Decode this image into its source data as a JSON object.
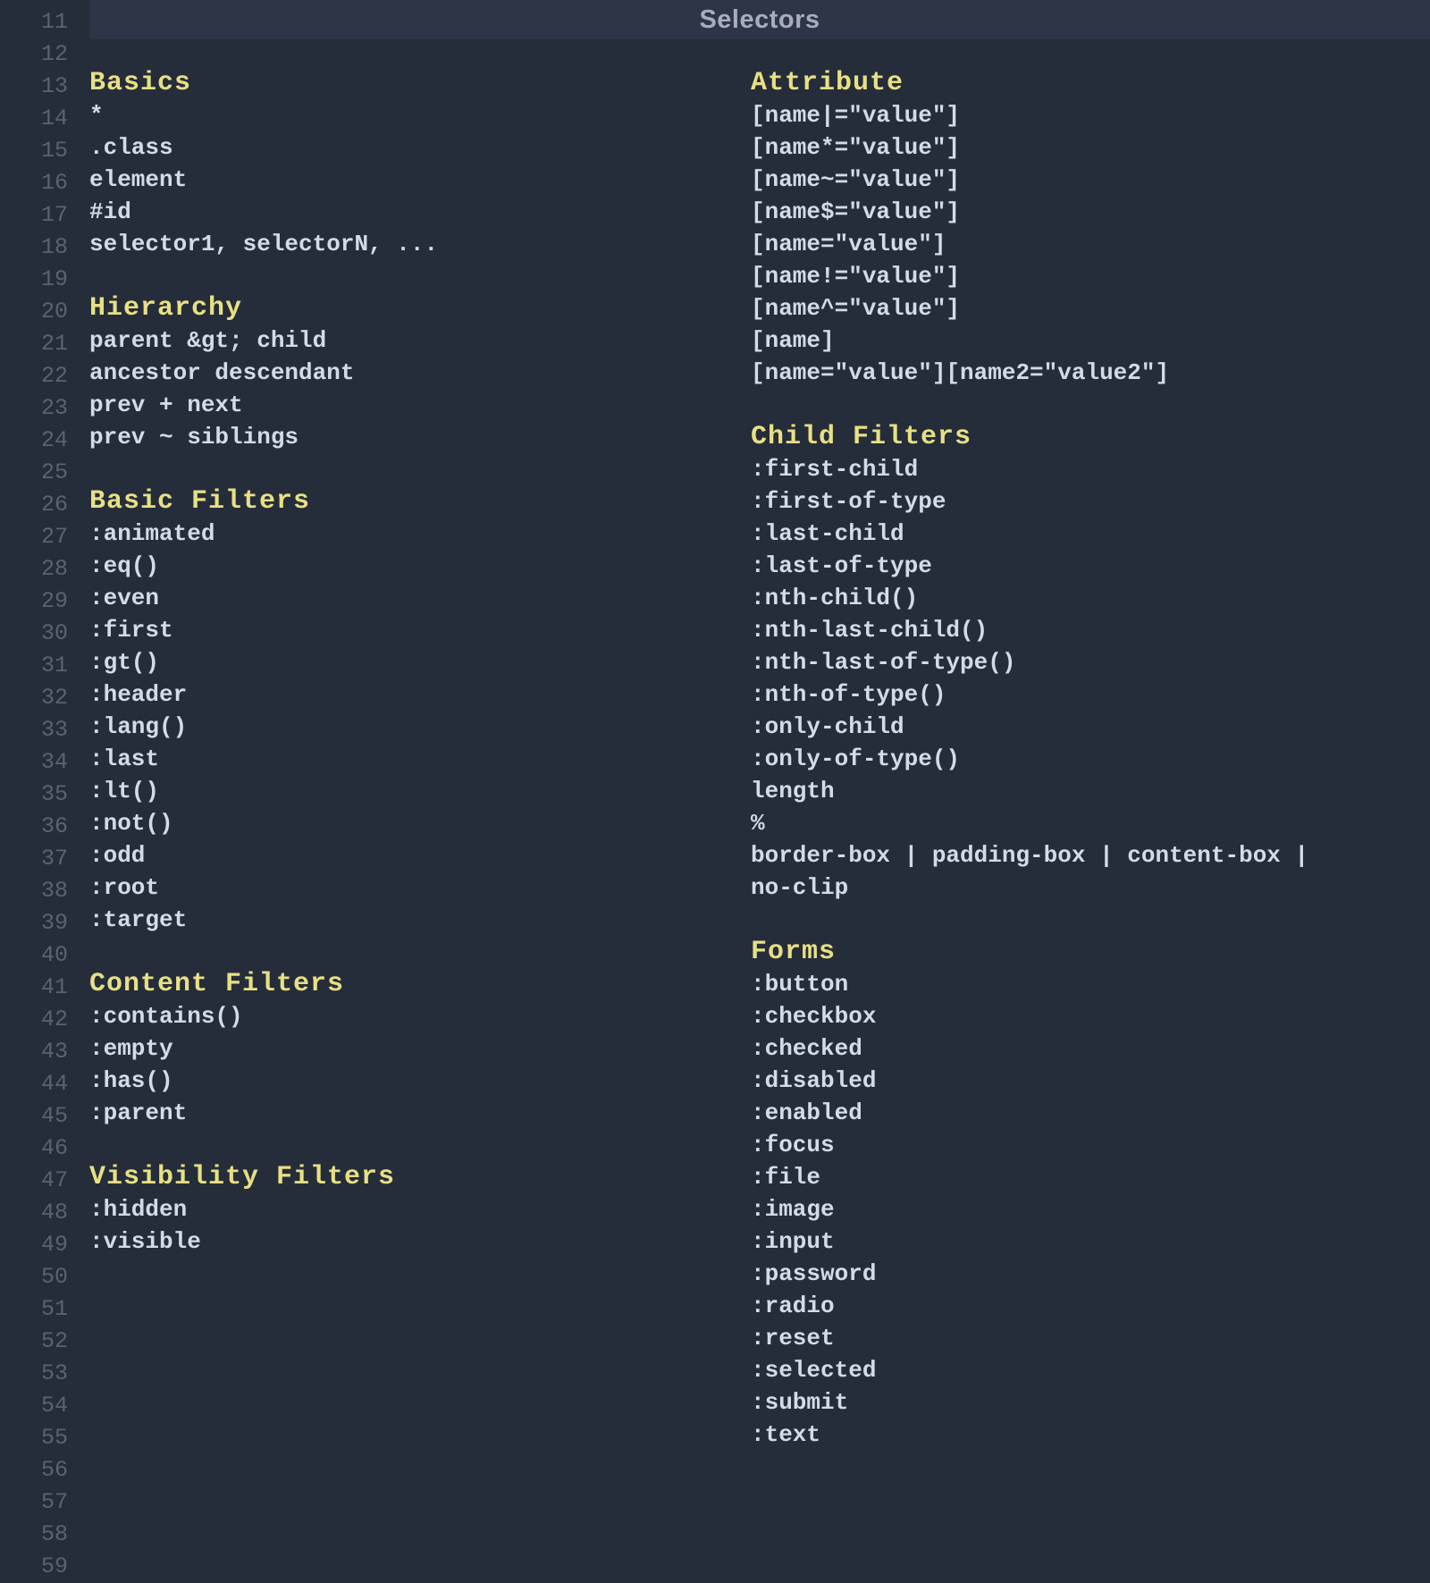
{
  "title": "Selectors",
  "line_start": 11,
  "line_end": 59,
  "columns": [
    {
      "sections": [
        {
          "heading": "Basics",
          "items": [
            "*",
            ".class",
            "element",
            "#id",
            "selector1, selectorN, ..."
          ]
        },
        {
          "heading": "Hierarchy",
          "items": [
            "parent &gt; child",
            "ancestor descendant",
            "prev + next",
            "prev ~ siblings"
          ]
        },
        {
          "heading": "Basic Filters",
          "items": [
            ":animated",
            ":eq()",
            ":even",
            ":first",
            ":gt()",
            ":header",
            ":lang()",
            ":last",
            ":lt()",
            ":not()",
            ":odd",
            ":root",
            ":target"
          ]
        },
        {
          "heading": "Content Filters",
          "items": [
            ":contains()",
            ":empty",
            ":has()",
            ":parent"
          ]
        },
        {
          "heading": "Visibility Filters",
          "items": [
            ":hidden",
            ":visible"
          ]
        }
      ]
    },
    {
      "sections": [
        {
          "heading": "Attribute",
          "items": [
            "[name|=\"value\"]",
            "[name*=\"value\"]",
            "[name~=\"value\"]",
            "[name$=\"value\"]",
            "[name=\"value\"]",
            "[name!=\"value\"]",
            "[name^=\"value\"]",
            "[name]",
            "[name=\"value\"][name2=\"value2\"]"
          ]
        },
        {
          "heading": "Child Filters",
          "items": [
            ":first-child",
            ":first-of-type",
            ":last-child",
            ":last-of-type",
            ":nth-child()",
            ":nth-last-child()",
            ":nth-last-of-type()",
            ":nth-of-type()",
            ":only-child",
            ":only-of-type()",
            "length",
            "%",
            "border-box | padding-box | content-box |",
            "no-clip"
          ]
        },
        {
          "heading": "Forms",
          "items": [
            ":button",
            ":checkbox",
            ":checked",
            ":disabled",
            ":enabled",
            ":focus",
            ":file",
            ":image",
            ":input",
            ":password",
            ":radio",
            ":reset",
            ":selected",
            ":submit",
            ":text"
          ]
        }
      ]
    }
  ]
}
